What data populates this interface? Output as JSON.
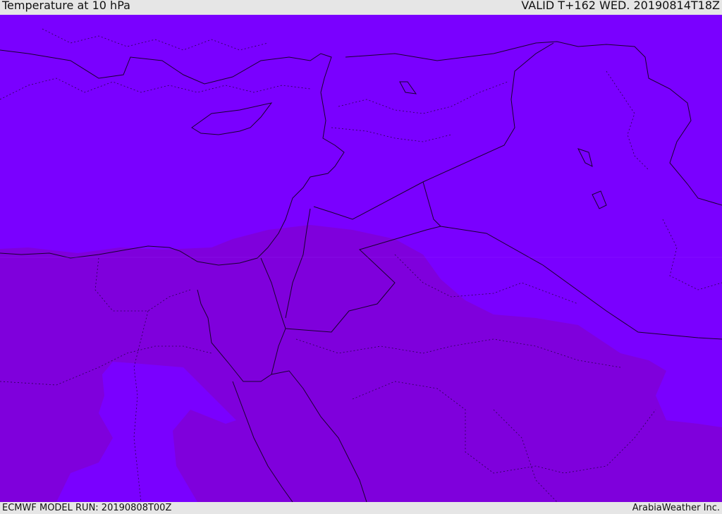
{
  "header": {
    "title": "Temperature at 10 hPa",
    "valid": "VALID T+162 WED. 20190814T18Z"
  },
  "footer": {
    "model_run": "ECMWF MODEL RUN: 20190808T00Z",
    "brand": "ArabiaWeather Inc."
  },
  "map": {
    "colors": {
      "cold_zone": "#7a00ff",
      "warm_zone": "#7f00dc",
      "border": "#1a0030"
    }
  }
}
